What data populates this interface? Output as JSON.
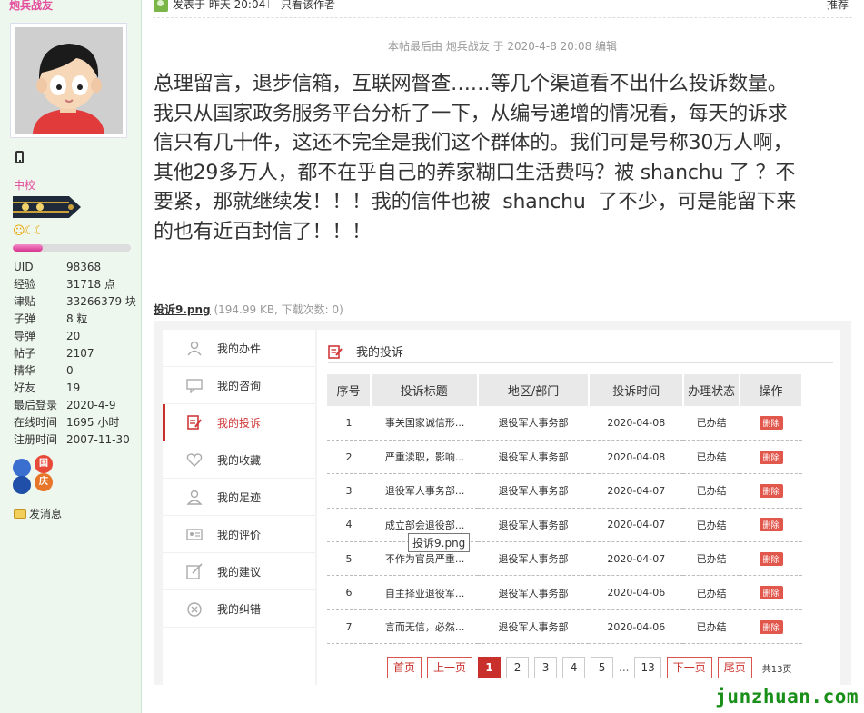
{
  "user": {
    "name": "炮兵战友",
    "rank": "中校",
    "level_fraction": 0.25,
    "stats": [
      {
        "label": "UID",
        "value": "98368"
      },
      {
        "label": "经验",
        "value": "31718 点"
      },
      {
        "label": "津贴",
        "value": "33266379 块"
      },
      {
        "label": "子弹",
        "value": "8 粒"
      },
      {
        "label": "导弹",
        "value": "20"
      },
      {
        "label": "帖子",
        "value": "2107"
      },
      {
        "label": "精华",
        "value": "0"
      },
      {
        "label": "好友",
        "value": "19"
      },
      {
        "label": "最后登录",
        "value": "2020-4-9"
      },
      {
        "label": "在线时间",
        "value": "1695 小时"
      },
      {
        "label": "注册时间",
        "value": "2007-11-30"
      }
    ],
    "medals": [
      "国",
      "庆"
    ],
    "send_message": "发消息"
  },
  "post": {
    "posted_at": "发表于 昨天 20:04",
    "only_author": "只看该作者",
    "recommend": "推荐",
    "edit_note": "本帖最后由 炮兵战友 于 2020-4-8 20:08 编辑",
    "body_lines": [
      "总理留言，退步信箱，互联网督查……等几个渠道看不出什么投诉数量。",
      "我只从国家政务服务平台分析了一下，从编号递增的情况看，每天的诉求",
      "信只有几十件，这还不完全是我们这个群体的。我们可是号称30万人啊，",
      "其他29多万人，都不在乎自己的养家糊口生活费吗？被 shanchu 了 ？不",
      "要紧，那就继续发！！！我的信件也被  shanchu  了不少，可是能留下来",
      "的也有近百封信了！！！"
    ],
    "attachment": {
      "name": "投诉9.png",
      "meta": "(194.99 KB, 下载次数: 0)"
    }
  },
  "screenshot": {
    "menu": [
      {
        "label": "我的办件",
        "icon": "user-doc-icon",
        "active": false
      },
      {
        "label": "我的咨询",
        "icon": "chat-icon",
        "active": false
      },
      {
        "label": "我的投诉",
        "icon": "complaint-icon",
        "active": true
      },
      {
        "label": "我的收藏",
        "icon": "heart-icon",
        "active": false
      },
      {
        "label": "我的足迹",
        "icon": "footprint-icon",
        "active": false
      },
      {
        "label": "我的评价",
        "icon": "id-card-icon",
        "active": false
      },
      {
        "label": "我的建议",
        "icon": "edit-icon",
        "active": false
      },
      {
        "label": "我的纠错",
        "icon": "correct-icon",
        "active": false
      }
    ],
    "title": "我的投诉",
    "columns": [
      "序号",
      "投诉标题",
      "地区/部门",
      "投诉时间",
      "办理状态",
      "操作"
    ],
    "rows": [
      [
        "1",
        "事关国家诚信形...",
        "退役军人事务部",
        "2020-04-08",
        "已办结"
      ],
      [
        "2",
        "严重渎职，影响...",
        "退役军人事务部",
        "2020-04-08",
        "已办结"
      ],
      [
        "3",
        "退役军人事务部...",
        "退役军人事务部",
        "2020-04-07",
        "已办结"
      ],
      [
        "4",
        "成立部会退役部...",
        "退役军人事务部",
        "2020-04-07",
        "已办结"
      ],
      [
        "5",
        "不作为官员严重...",
        "退役军人事务部",
        "2020-04-07",
        "已办结"
      ],
      [
        "6",
        "自主择业退役军...",
        "退役军人事务部",
        "2020-04-06",
        "已办结"
      ],
      [
        "7",
        "言而无信，必然...",
        "退役军人事务部",
        "2020-04-06",
        "已办结"
      ]
    ],
    "delete_label": "删除",
    "tooltip": "投诉9.png",
    "pager": {
      "first": "首页",
      "prev": "上一页",
      "pages": [
        "1",
        "2",
        "3",
        "4",
        "5"
      ],
      "ellipsis": "...",
      "last_page": "13",
      "next": "下一页",
      "end": "尾页",
      "total": "共13页"
    }
  },
  "watermark": "junzhuan.com",
  "colors": {
    "accent_pink": "#e34d9b",
    "accent_red": "#c9302c",
    "delete_red": "#e2574c",
    "watermark_green": "#1a8f1a"
  }
}
